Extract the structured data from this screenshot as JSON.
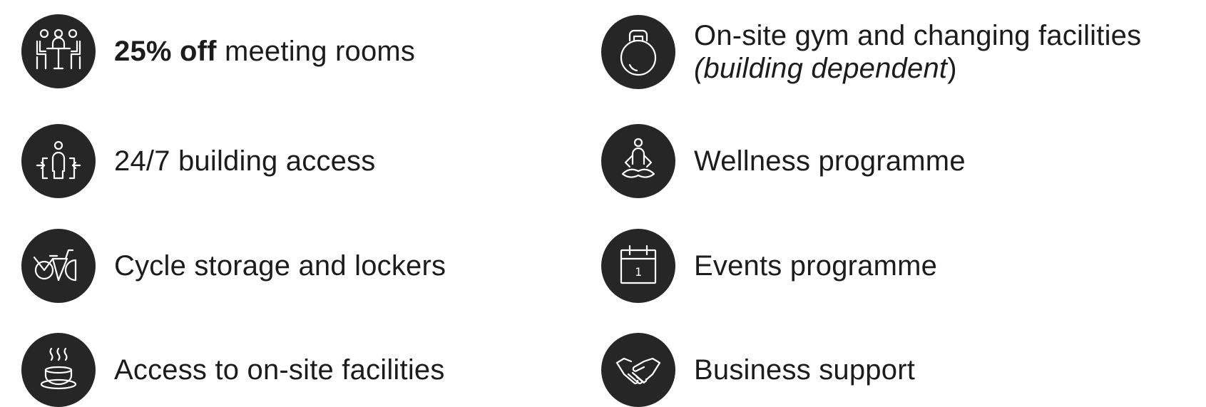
{
  "features": {
    "meeting_rooms": {
      "icon": "meeting-table-icon",
      "bold": "25% off",
      "text": " meeting rooms"
    },
    "building_access": {
      "icon": "building-access-icon",
      "text": "24/7 building access"
    },
    "cycle_storage": {
      "icon": "bicycle-icon",
      "text": "Cycle storage and lockers"
    },
    "onsite_facilities": {
      "icon": "coffee-cup-icon",
      "text": "Access to on-site facilities"
    },
    "gym": {
      "icon": "kettlebell-icon",
      "line1": "On-site gym and changing facilities",
      "italic": "(building dependent",
      "close": ")"
    },
    "wellness": {
      "icon": "meditation-icon",
      "text": "Wellness programme"
    },
    "events": {
      "icon": "calendar-icon",
      "calendar_day": "1",
      "text": "Events programme"
    },
    "business_support": {
      "icon": "handshake-icon",
      "text": "Business support"
    }
  },
  "colors": {
    "icon_background": "#262626",
    "icon_stroke": "#ffffff",
    "text": "#1c1c1c"
  }
}
